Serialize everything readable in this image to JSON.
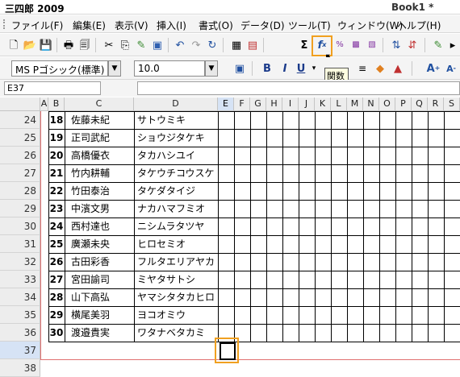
{
  "window": {
    "app_title": "三四郎 2009",
    "doc_title": "Book1 *"
  },
  "menu": [
    "ファイル(F)",
    "編集(E)",
    "表示(V)",
    "挿入(I)",
    "書式(O)",
    "データ(D)",
    "ツール(T)",
    "ウィンドウ(W)",
    "ヘルプ(H)"
  ],
  "format_bar": {
    "font_name": "MS Pゴシック(標準)",
    "font_size": "10.0"
  },
  "tooltip": "関数",
  "name_box": "E37",
  "columns": [
    "A",
    "B",
    "C",
    "D",
    "E",
    "F",
    "G",
    "H",
    "I",
    "J",
    "K",
    "L",
    "M",
    "N",
    "O",
    "P",
    "Q",
    "R",
    "S"
  ],
  "selected_column": "E",
  "rows": [
    {
      "row": "24",
      "no": "18",
      "name": "佐藤未紀",
      "kana": "サトウミキ"
    },
    {
      "row": "25",
      "no": "19",
      "name": "正司武紀",
      "kana": "ショウジタケキ"
    },
    {
      "row": "26",
      "no": "20",
      "name": "高橋優衣",
      "kana": "タカハシユイ"
    },
    {
      "row": "27",
      "no": "21",
      "name": "竹内耕輔",
      "kana": "タケウチコウスケ"
    },
    {
      "row": "28",
      "no": "22",
      "name": "竹田泰治",
      "kana": "タケダタイジ"
    },
    {
      "row": "29",
      "no": "23",
      "name": "中濱文男",
      "kana": "ナカハマフミオ"
    },
    {
      "row": "30",
      "no": "24",
      "name": "西村達也",
      "kana": "ニシムラタツヤ"
    },
    {
      "row": "31",
      "no": "25",
      "name": "廣瀬未央",
      "kana": "ヒロセミオ"
    },
    {
      "row": "32",
      "no": "26",
      "name": "古田彩香",
      "kana": "フルタエリアヤカ"
    },
    {
      "row": "33",
      "no": "27",
      "name": "宮田諭司",
      "kana": "ミヤタサトシ"
    },
    {
      "row": "34",
      "no": "28",
      "name": "山下高弘",
      "kana": "ヤマシタタカヒロ"
    },
    {
      "row": "35",
      "no": "29",
      "name": "横尾美羽",
      "kana": "ヨコオミウ"
    },
    {
      "row": "36",
      "no": "30",
      "name": "渡邉貴実",
      "kana": "ワタナベタカミ"
    },
    {
      "row": "37",
      "no": "",
      "name": "",
      "kana": ""
    },
    {
      "row": "38",
      "no": "",
      "name": "",
      "kana": ""
    }
  ],
  "selected_row": "37",
  "icons": {
    "toolbar1": [
      "new-file-icon",
      "open-folder-icon",
      "save-icon",
      "print-icon",
      "print-preview-icon",
      "cut-icon",
      "copy-icon",
      "format-painter-icon",
      "paste-icon",
      "undo-icon",
      "redo-icon",
      "repeat-icon",
      "borders-icon",
      "grid-icon",
      "sum-icon",
      "function-icon",
      "number-format-icon",
      "cell-style-icon",
      "cell-format-icon",
      "sort-asc-icon",
      "sort-desc-icon",
      "edit-icon"
    ],
    "toolbar2": [
      "paste-special-icon",
      "bold-icon",
      "italic-icon",
      "underline-icon",
      "strikethrough-icon",
      "align-left-icon",
      "font-color-icon",
      "fill-color-icon",
      "increase-font-icon",
      "decrease-font-icon"
    ]
  }
}
